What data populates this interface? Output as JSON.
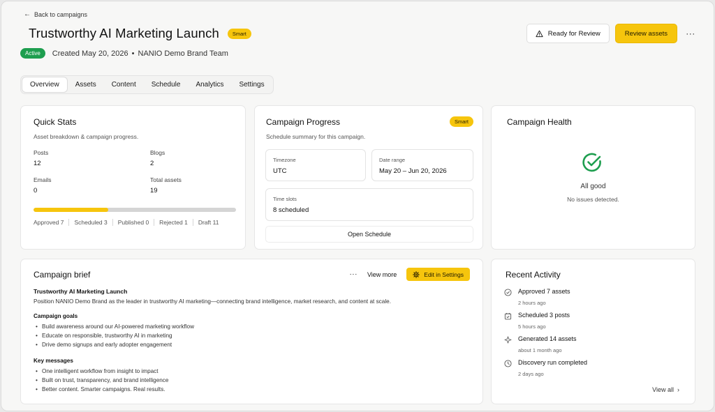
{
  "nav": {
    "back_label": "Back to campaigns"
  },
  "header": {
    "title": "Trustworthy AI Marketing Launch",
    "title_badge": "Smart",
    "status": "Active",
    "created": "Created May 20, 2026",
    "separator": "•",
    "team": "NANIO Demo Brand Team",
    "ready_label": "Ready for Review",
    "review_label": "Review assets",
    "more_label": "···"
  },
  "tabs": [
    {
      "label": "Overview",
      "active": true
    },
    {
      "label": "Assets"
    },
    {
      "label": "Content"
    },
    {
      "label": "Schedule"
    },
    {
      "label": "Analytics"
    },
    {
      "label": "Settings"
    }
  ],
  "quick_stats": {
    "title": "Quick Stats",
    "subtitle": "Asset breakdown & campaign progress.",
    "posts_label": "Posts",
    "posts_value": "12",
    "blogs_label": "Blogs",
    "blogs_value": "2",
    "emails_label": "Emails",
    "emails_value": "0",
    "total_label": "Total assets",
    "total_value": "19",
    "progress_fraction": 0.37,
    "breakdown": [
      "Approved 7",
      "Scheduled 3",
      "Published 0",
      "Rejected 1",
      "Draft 11"
    ]
  },
  "campaign_progress": {
    "title": "Campaign Progress",
    "badge": "Smart",
    "subtitle": "Schedule summary for this campaign.",
    "timezone_label": "Timezone",
    "timezone_value": "UTC",
    "date_label": "Date range",
    "date_value": "May 20 – Jun 20, 2026",
    "slots_label": "Time slots",
    "slots_value": "8 scheduled",
    "open_label": "Open Schedule"
  },
  "campaign_health": {
    "title": "Campaign Health",
    "status": "All good",
    "detail": "No issues detected.",
    "icon": "check-circle-icon",
    "color": "#1e9e4f"
  },
  "brief": {
    "title": "Campaign brief",
    "more_label": "···",
    "view_more_label": "View more",
    "edit_label": "Edit in Settings",
    "name": "Trustworthy AI Marketing Launch",
    "description": "Position NANIO Demo Brand as the leader in trustworthy AI marketing—connecting brand intelligence, market research, and content at scale.",
    "goals_heading": "Campaign goals",
    "goals": [
      "Build awareness around our AI-powered marketing workflow",
      "Educate on responsible, trustworthy AI in marketing",
      "Drive demo signups and early adopter engagement"
    ],
    "messages_heading": "Key messages",
    "messages": [
      "One intelligent workflow from insight to impact",
      "Built on trust, transparency, and brand intelligence",
      "Better content. Smarter campaigns. Real results."
    ]
  },
  "recent_activity": {
    "title": "Recent Activity",
    "items": [
      {
        "title": "Approved 7 assets",
        "time": "2 hours ago",
        "icon": "check-circle-icon"
      },
      {
        "title": "Scheduled 3 posts",
        "time": "5 hours ago",
        "icon": "calendar-check-icon"
      },
      {
        "title": "Generated 14 assets",
        "time": "about 1 month ago",
        "icon": "sparkle-icon"
      },
      {
        "title": "Discovery run completed",
        "time": "2 days ago",
        "icon": "clock-icon"
      }
    ],
    "view_all_label": "View all"
  },
  "colors": {
    "accent": "#f6c50d",
    "success": "#1e9e4f"
  }
}
